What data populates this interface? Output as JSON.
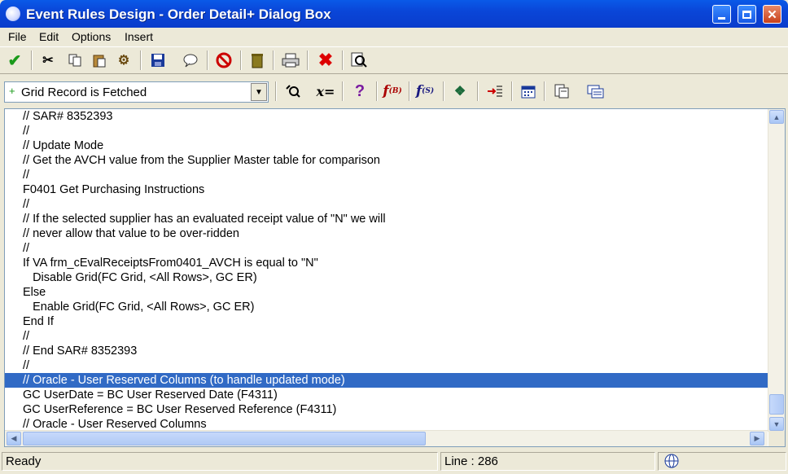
{
  "window": {
    "title": "Event Rules Design - Order Detail+ Dialog Box"
  },
  "menu": [
    "File",
    "Edit",
    "Options",
    "Insert"
  ],
  "toolbar1": {
    "icons": [
      "ok-check-icon",
      "cut-icon",
      "copy-icon",
      "paste-icon",
      "find-replace-icon",
      "save-icon",
      "comment-icon",
      "cancel-circle-icon",
      "delete-trash-icon",
      "print-icon",
      "close-x-icon",
      "search-icon"
    ]
  },
  "toolbar2": {
    "event_selected": "Grid Record is Fetched",
    "icons": [
      "search-find-icon",
      "assignment-icon",
      "help-question-icon",
      "business-function-icon",
      "system-function-icon",
      "table-io-icon",
      "insert-line-icon",
      "calendar-icon",
      "form-interconnect-icon",
      "report-interconnect-icon"
    ]
  },
  "editor": {
    "lines": [
      "// SAR# 8352393",
      "//",
      "// Update Mode",
      "// Get the AVCH value from the Supplier Master table for comparison",
      "//",
      "F0401 Get Purchasing Instructions",
      "//",
      "// If the selected supplier has an evaluated receipt value of \"N\" we will",
      "// never allow that value to be over-ridden",
      "//",
      "If VA frm_cEvalReceiptsFrom0401_AVCH is equal to \"N\"",
      "   Disable Grid(FC Grid, <All Rows>, GC ER)",
      "Else",
      "   Enable Grid(FC Grid, <All Rows>, GC ER)",
      "End If",
      "//",
      "// End SAR# 8352393",
      "//",
      "// Oracle - User Reserved Columns (to handle updated mode)",
      "GC UserDate = BC User Reserved Date (F4311)",
      "GC UserReference = BC User Reserved Reference (F4311)",
      "// Oracle - User Reserved Columns"
    ],
    "selected_line": 19
  },
  "status": {
    "text": "Ready",
    "line": "Line : 286"
  }
}
